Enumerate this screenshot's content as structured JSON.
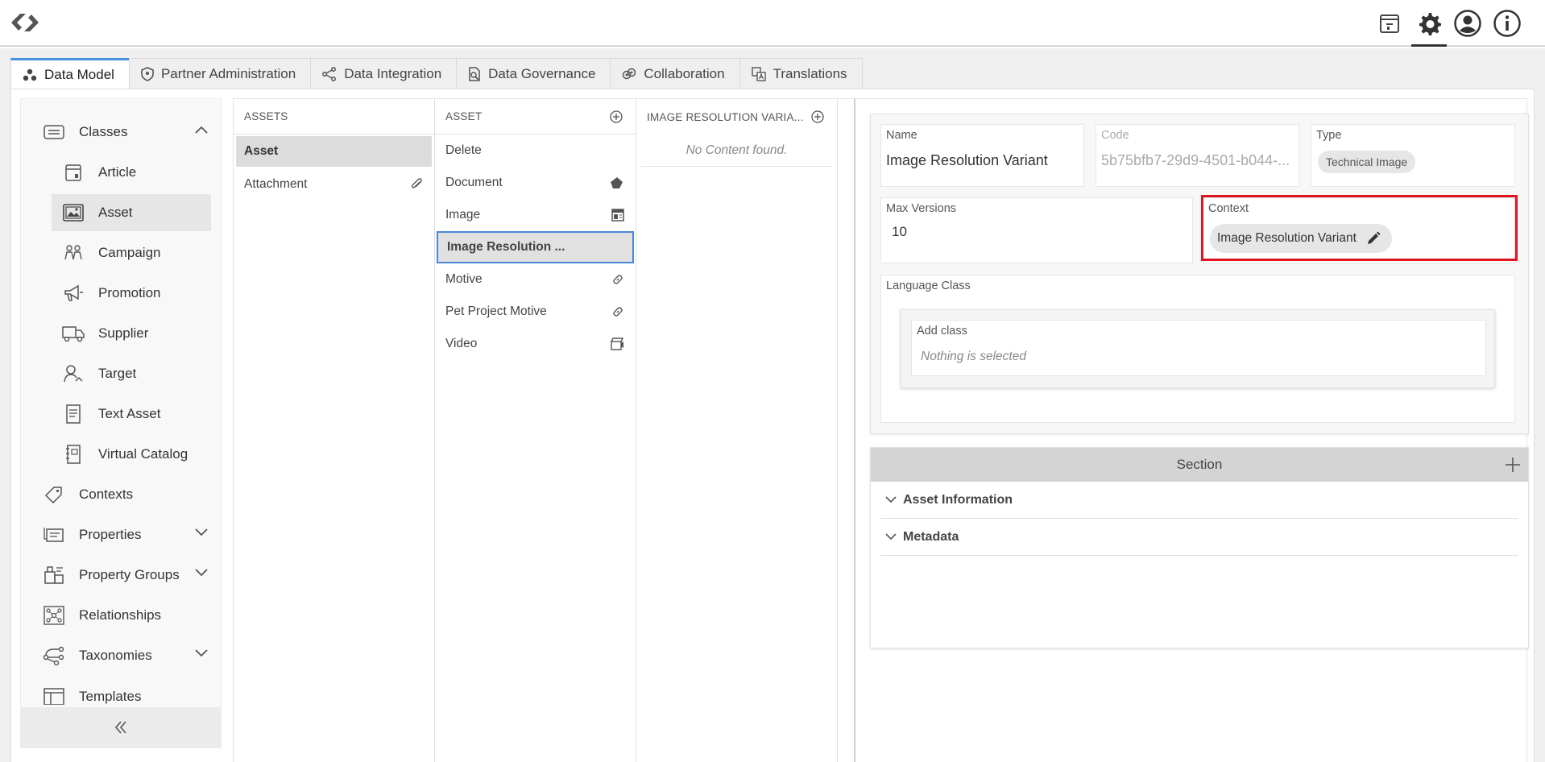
{
  "header": {
    "icons": [
      "logo-icon",
      "archive-icon",
      "gear-icon",
      "user-icon",
      "info-icon"
    ]
  },
  "tabs": [
    {
      "label": "Data Model",
      "icon": "data-model-icon",
      "active": true
    },
    {
      "label": "Partner Administration",
      "icon": "shield-icon"
    },
    {
      "label": "Data Integration",
      "icon": "integration-icon"
    },
    {
      "label": "Data Governance",
      "icon": "governance-icon"
    },
    {
      "label": "Collaboration",
      "icon": "collaboration-icon"
    },
    {
      "label": "Translations",
      "icon": "translate-icon"
    }
  ],
  "sidebar": {
    "items": [
      {
        "label": "Classes",
        "icon": "classes-icon",
        "expanded": true
      },
      {
        "label": "Article",
        "icon": "article-icon"
      },
      {
        "label": "Asset",
        "icon": "image-icon",
        "selected": true
      },
      {
        "label": "Campaign",
        "icon": "campaign-icon"
      },
      {
        "label": "Promotion",
        "icon": "megaphone-icon"
      },
      {
        "label": "Supplier",
        "icon": "truck-icon"
      },
      {
        "label": "Target",
        "icon": "target-icon"
      },
      {
        "label": "Text Asset",
        "icon": "text-doc-icon"
      },
      {
        "label": "Virtual Catalog",
        "icon": "catalog-icon"
      },
      {
        "label": "Contexts",
        "icon": "tag-icon"
      },
      {
        "label": "Properties",
        "icon": "properties-icon"
      },
      {
        "label": "Property Groups",
        "icon": "property-groups-icon"
      },
      {
        "label": "Relationships",
        "icon": "relationships-icon"
      },
      {
        "label": "Taxonomies",
        "icon": "taxonomy-icon"
      },
      {
        "label": "Templates",
        "icon": "templates-icon"
      }
    ]
  },
  "columns": {
    "assets": {
      "header": "ASSETS",
      "rows": [
        "Asset",
        "Attachment"
      ]
    },
    "asset": {
      "header": "ASSET",
      "rows": [
        "Delete",
        "Document",
        "Image",
        "Image Resolution ...",
        "Motive",
        "Pet Project Motive",
        "Video"
      ]
    },
    "variants": {
      "header": "IMAGE RESOLUTION VARIA...",
      "empty_text": "No Content found."
    }
  },
  "detail": {
    "name_label": "Name",
    "name_value": "Image Resolution Variant",
    "code_label": "Code",
    "code_value": "5b75bfb7-29d9-4501-b044-...",
    "type_label": "Type",
    "type_value": "Technical Image",
    "max_versions_label": "Max Versions",
    "max_versions_value": "10",
    "context_label": "Context",
    "context_value": "Image Resolution Variant",
    "language_class_label": "Language Class",
    "add_class_label": "Add class",
    "add_class_placeholder": "Nothing is selected",
    "section_title": "Section",
    "sections": [
      "Asset Information",
      "Metadata"
    ]
  },
  "colors": {
    "accent": "#4a90e2",
    "highlight": "#e0141e"
  }
}
